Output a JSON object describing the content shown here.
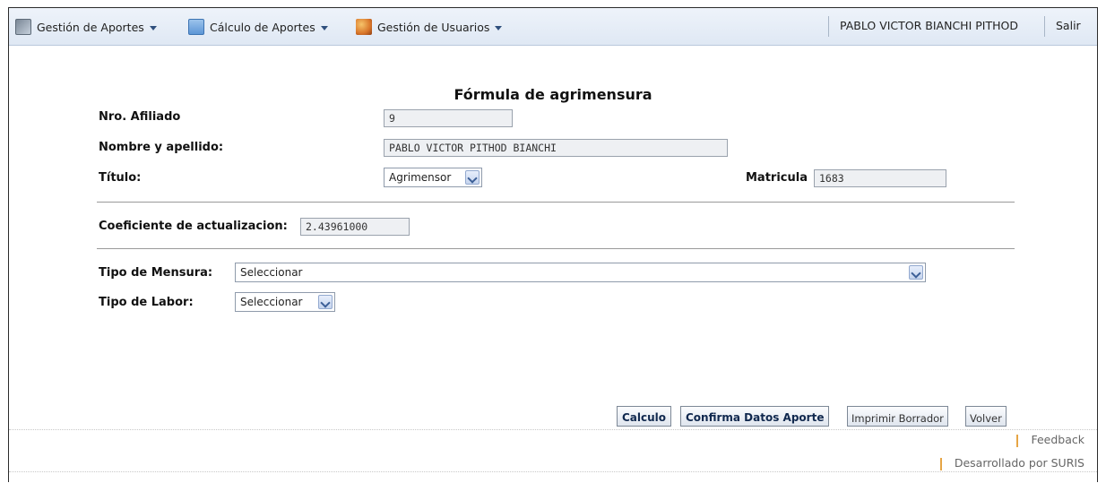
{
  "menu": {
    "items": [
      {
        "label": "Gestión de Aportes",
        "icon": "folder-icon"
      },
      {
        "label": "Cálculo de Aportes",
        "icon": "calculator-icon"
      },
      {
        "label": "Gestión de Usuarios",
        "icon": "users-icon"
      }
    ],
    "user_name": "PABLO VICTOR BIANCHI PITHOD",
    "logout_label": "Salir"
  },
  "form": {
    "title": "Fórmula de agrimensura",
    "afiliado": {
      "label": "Nro. Afiliado",
      "value": "9"
    },
    "nombre": {
      "label": "Nombre y apellido:",
      "value": "PABLO VICTOR PITHOD BIANCHI"
    },
    "titulo": {
      "label": "Título:",
      "value": "Agrimensor"
    },
    "matricula": {
      "label": "Matricula",
      "value": "1683"
    },
    "coeficiente": {
      "label": "Coeficiente de actualizacion:",
      "value": "2.43961000"
    },
    "tipo_mensura": {
      "label": "Tipo de Mensura:",
      "value": "Seleccionar"
    },
    "tipo_labor": {
      "label": "Tipo de Labor:",
      "value": "Seleccionar"
    }
  },
  "buttons": {
    "calculo": "Calculo",
    "confirma": "Confirma Datos Aporte",
    "imprimir": "Imprimir Borrador",
    "volver": "Volver"
  },
  "footer": {
    "feedback": "Feedback",
    "credits": "Desarrollado por SURIS"
  }
}
